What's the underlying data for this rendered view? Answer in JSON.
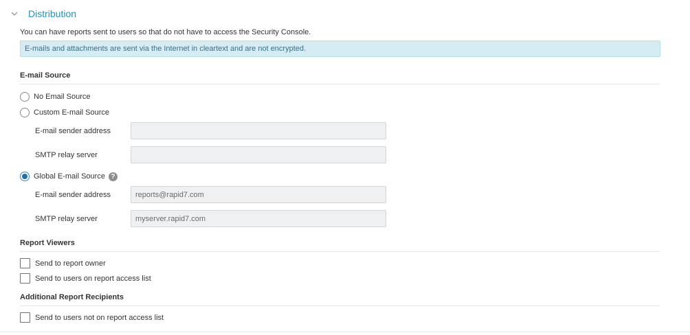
{
  "section": {
    "title": "Distribution",
    "icon": "chevron-down-icon"
  },
  "intro_text": "You can have reports sent to users so that do not have to access the Security Console.",
  "notice_text": "E-mails and attachments are sent via the Internet in cleartext and are not encrypted.",
  "email_source": {
    "title": "E-mail Source",
    "options": {
      "none": {
        "label": "No Email Source",
        "checked": false
      },
      "custom": {
        "label": "Custom E-mail Source",
        "checked": false
      },
      "global": {
        "label": "Global E-mail Source",
        "checked": true
      }
    },
    "custom_fields": {
      "sender_label": "E-mail sender address",
      "sender_value": "",
      "smtp_label": "SMTP relay server",
      "smtp_value": ""
    },
    "global_fields": {
      "sender_label": "E-mail sender address",
      "sender_value": "reports@rapid7.com",
      "smtp_label": "SMTP relay server",
      "smtp_value": "myserver.rapid7.com"
    },
    "help_icon": "question-icon"
  },
  "report_viewers": {
    "title": "Report Viewers",
    "options": [
      {
        "label": "Send to report owner",
        "checked": false
      },
      {
        "label": "Send to users on report access list",
        "checked": false
      }
    ]
  },
  "additional_recipients": {
    "title": "Additional Report Recipients",
    "options": [
      {
        "label": "Send to users not on report access list",
        "checked": false
      }
    ]
  },
  "colors": {
    "accent": "#2b8fb0",
    "notice_bg": "#d6ecf5",
    "field_bg": "#eef0f2"
  }
}
